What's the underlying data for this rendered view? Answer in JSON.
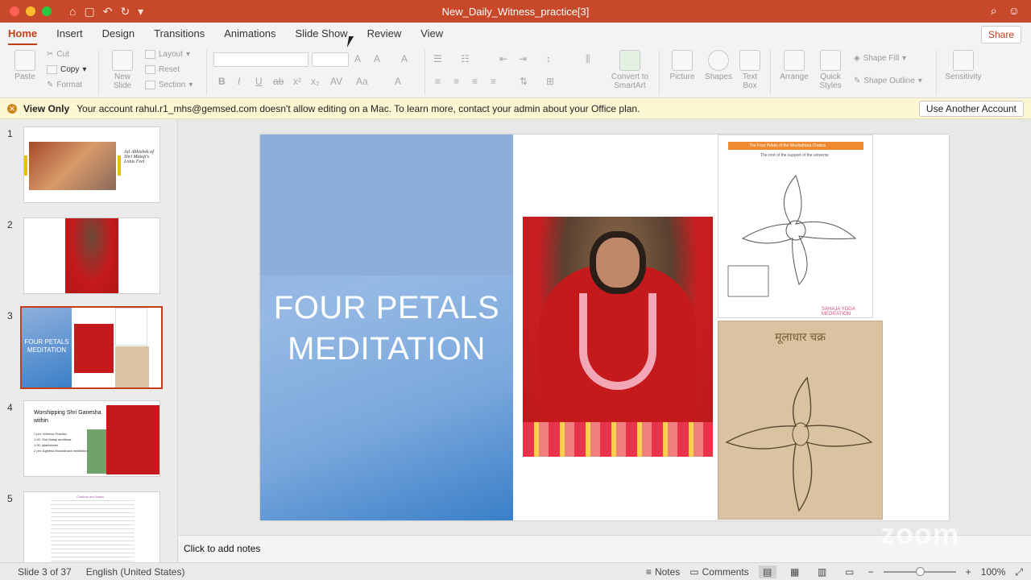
{
  "window": {
    "title": "New_Daily_Witness_practice[3]"
  },
  "tabs": [
    "Home",
    "Insert",
    "Design",
    "Transitions",
    "Animations",
    "Slide Show",
    "Review",
    "View"
  ],
  "share_label": "Share",
  "ribbon": {
    "paste": "Paste",
    "cut": "Cut",
    "copy": "Copy",
    "format": "Format",
    "new_slide": "New Slide",
    "layout": "Layout",
    "reset": "Reset",
    "section": "Section",
    "convert": "Convert to SmartArt",
    "picture": "Picture",
    "shapes": "Shapes",
    "text_box": "Text Box",
    "arrange": "Arrange",
    "quick_styles": "Quick Styles",
    "shape_fill": "Shape Fill",
    "shape_outline": "Shape Outline",
    "sensitivity": "Sensitivity"
  },
  "message": {
    "label": "View Only",
    "text": "Your account rahul.r1_mhs@gemsed.com doesn't allow editing on a Mac. To learn more, contact your admin about your Office plan.",
    "button": "Use Another Account"
  },
  "thumbnails": [
    {
      "num": "1",
      "caption": "Jal Abhishek of Shri Mataji's Lotus Feet"
    },
    {
      "num": "2"
    },
    {
      "num": "3",
      "title": "FOUR PETALS MEDITATION"
    },
    {
      "num": "4",
      "title": "Worshipping Shri Ganesha within",
      "bullets": [
        "1 pm: Witness Practice",
        "1:20: Shri Mataji amrithsar",
        "1:30: jalabhishek",
        "2 pm: Ageless Mooladhara meditation"
      ]
    },
    {
      "num": "5",
      "title": "Chakras and Nadis"
    }
  ],
  "slide": {
    "title_line1": "FOUR PETALS",
    "title_line2": "MEDITATION",
    "chart_header": "The Four Petals of the Mooladhara Chakra",
    "chart_sub": "The root of the support of the universe",
    "handwritten_title": "मूलाधार चक्र",
    "logo": "SAHAJA YOGA MEDITATION"
  },
  "notes_placeholder": "Click to add notes",
  "watermark": "zoom",
  "status": {
    "slide": "Slide 3 of 37",
    "language": "English (United States)",
    "notes": "Notes",
    "comments": "Comments",
    "zoom": "100%"
  }
}
